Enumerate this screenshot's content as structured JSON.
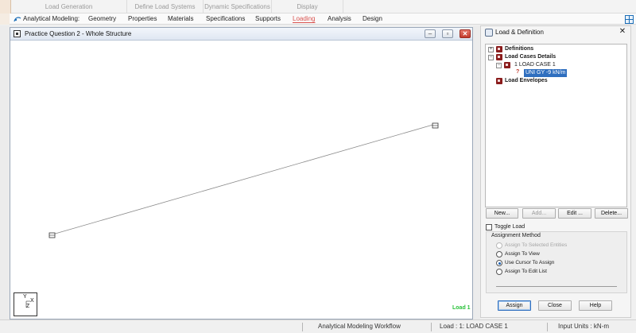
{
  "subtabs": [
    "Load Generation",
    "Define Load Systems",
    "Dynamic Specifications",
    "Display"
  ],
  "menu": {
    "mode_label": "Analytical Modeling:",
    "items": [
      "Geometry",
      "Properties",
      "Materials",
      "Specifications",
      "Supports",
      "Loading",
      "Analysis",
      "Design"
    ],
    "active": "Loading"
  },
  "structure_window": {
    "title": "Practice Question 2 - Whole Structure",
    "load_label": "Load 1",
    "axis_labels": {
      "y": "Y",
      "x": "X",
      "z": "Z"
    }
  },
  "panel": {
    "title": "Load & Definition",
    "tree": [
      {
        "label": "Definitions",
        "bold": true,
        "level": 0,
        "expander": "+"
      },
      {
        "label": "Load Cases Details",
        "bold": true,
        "level": 0,
        "expander": "−"
      },
      {
        "label": "1  LOAD CASE 1",
        "bold": false,
        "level": 1,
        "expander": "−"
      },
      {
        "label": "UNI GY -9 kN/m",
        "bold": false,
        "level": 2,
        "selected": true
      },
      {
        "label": "Load Envelopes",
        "bold": true,
        "level": 0
      }
    ],
    "buttons": {
      "new": "New...",
      "add": "Add...",
      "edit": "Edit ...",
      "delete": "Delete..."
    },
    "toggle_label": "Toggle Load",
    "assignment_method": {
      "title": "Assignment Method",
      "options": [
        {
          "label": "Assign To Selected Entities",
          "enabled": false,
          "checked": false
        },
        {
          "label": "Assign To View",
          "enabled": true,
          "checked": false
        },
        {
          "label": "Use Cursor To Assign",
          "enabled": true,
          "checked": true
        },
        {
          "label": "Assign To Edit List",
          "enabled": true,
          "checked": false
        }
      ]
    },
    "footer": {
      "assign": "Assign",
      "close": "Close",
      "help": "Help"
    }
  },
  "statusbar": {
    "workflow": "Analytical Modeling Workflow",
    "load": "Load : 1: LOAD CASE 1",
    "units": "Input Units : kN-m"
  },
  "colors": {
    "accent": "#2f6fbf",
    "active_tab": "#d9534f",
    "load_label": "#2bc23b"
  }
}
